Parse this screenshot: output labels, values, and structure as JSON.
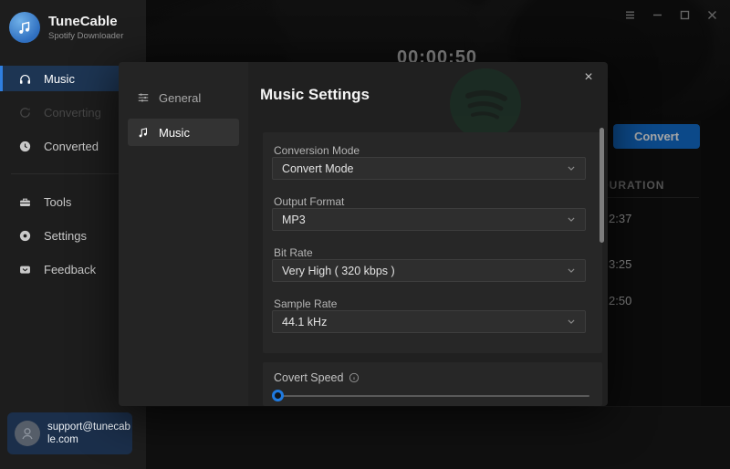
{
  "app": {
    "name": "TuneCable",
    "subtitle": "Spotify Downloader"
  },
  "titlebar": {
    "controls": [
      {
        "name": "menu"
      },
      {
        "name": "minimize"
      },
      {
        "name": "maximize"
      },
      {
        "name": "close"
      }
    ]
  },
  "sidebar": {
    "items": [
      {
        "label": "Music",
        "icon": "headphones-icon",
        "state": "active"
      },
      {
        "label": "Converting",
        "icon": "converting-icon",
        "state": "disabled"
      },
      {
        "label": "Converted",
        "icon": "clock-icon",
        "state": "normal"
      },
      {
        "label": "Tools",
        "icon": "toolbox-icon",
        "state": "normal"
      },
      {
        "label": "Settings",
        "icon": "gear-icon",
        "state": "normal"
      },
      {
        "label": "Feedback",
        "icon": "envelope-icon",
        "state": "normal"
      }
    ],
    "support_email": "support@tunecable.com"
  },
  "background": {
    "clipped_heading": "00:00:50",
    "convert_button": "Convert",
    "list": {
      "duration_header": "DURATION",
      "durations": [
        "2:37",
        "3:25",
        "2:50"
      ]
    }
  },
  "settings_dialog": {
    "title": "Music Settings",
    "close_label": "×",
    "tabs": [
      {
        "label": "General",
        "icon": "sliders-icon",
        "active": false
      },
      {
        "label": "Music",
        "icon": "music-note-icon",
        "active": true
      }
    ],
    "fields": [
      {
        "label": "Conversion Mode",
        "value": "Convert Mode"
      },
      {
        "label": "Output Format",
        "value": "MP3"
      },
      {
        "label": "Bit Rate",
        "value": "Very High ( 320 kbps )"
      },
      {
        "label": "Sample Rate",
        "value": "44.1 kHz"
      }
    ],
    "speed": {
      "label": "Covert Speed",
      "slider_percent": 0
    }
  },
  "colors": {
    "accent_blue": "#1371d3",
    "active_item_bg": "#1d3553",
    "spotify_green": "#17402a",
    "support_box_bg": "#1b2f4b"
  }
}
